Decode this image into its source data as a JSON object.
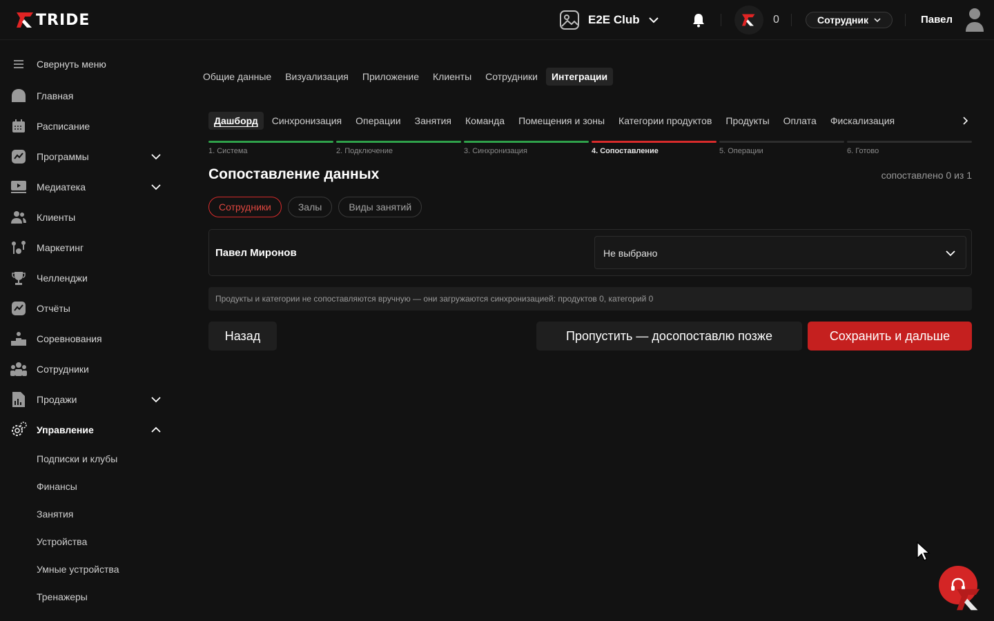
{
  "header": {
    "logo_text": "TRIDE",
    "club_name": "E2E Club",
    "points": "0",
    "role": "Сотрудник",
    "user_name": "Павел"
  },
  "sidebar": {
    "collapse_label": "Свернуть меню",
    "items": [
      {
        "label": "Главная",
        "icon": "home-icon"
      },
      {
        "label": "Расписание",
        "icon": "calendar-icon"
      },
      {
        "label": "Программы",
        "icon": "chart-icon"
      },
      {
        "label": "Медиатека",
        "icon": "media-icon"
      },
      {
        "label": "Клиенты",
        "icon": "users-icon"
      },
      {
        "label": "Маркетинг",
        "icon": "marketing-icon"
      },
      {
        "label": "Челленджи",
        "icon": "trophy-icon"
      },
      {
        "label": "Отчёты",
        "icon": "report-icon"
      },
      {
        "label": "Соревнования",
        "icon": "podium-icon"
      },
      {
        "label": "Сотрудники",
        "icon": "staff-icon"
      },
      {
        "label": "Продажи",
        "icon": "sales-icon"
      },
      {
        "label": "Управление",
        "icon": "gear-icon"
      }
    ],
    "sub_items": [
      "Подписки и клубы",
      "Финансы",
      "Занятия",
      "Устройства",
      "Умные устройства",
      "Тренажеры"
    ]
  },
  "main": {
    "top_tabs": [
      "Общие данные",
      "Визуализация",
      "Приложение",
      "Клиенты",
      "Сотрудники",
      "Интеграции"
    ],
    "integration_tabs": [
      "Дашборд",
      "Синхронизация",
      "Операции",
      "Занятия",
      "Команда",
      "Помещения и зоны",
      "Категории продуктов",
      "Продукты",
      "Оплата",
      "Фискализация"
    ],
    "steps": [
      "1. Система",
      "2. Подключение",
      "3. Синхронизация",
      "4. Сопоставление",
      "5. Операции",
      "6. Готово"
    ],
    "title": "Сопоставление данных",
    "matched": "сопоставлено 0 из 1",
    "pills": [
      "Сотрудники",
      "Залы",
      "Виды занятий"
    ],
    "row_name": "Павел Миронов",
    "select_value": "Не выбрано",
    "note": "Продукты и категории не сопоставляются вручную — они загружаются синхронизацией: продуктов 0, категорий 0",
    "back_label": "Назад",
    "skip_label": "Пропустить — досопоставлю позже",
    "save_label": "Сохранить и дальше"
  },
  "colors": {
    "accent": "#c5201f",
    "step_done": "#2fa14a",
    "step_current": "#d82b2b",
    "background": "#121212"
  }
}
